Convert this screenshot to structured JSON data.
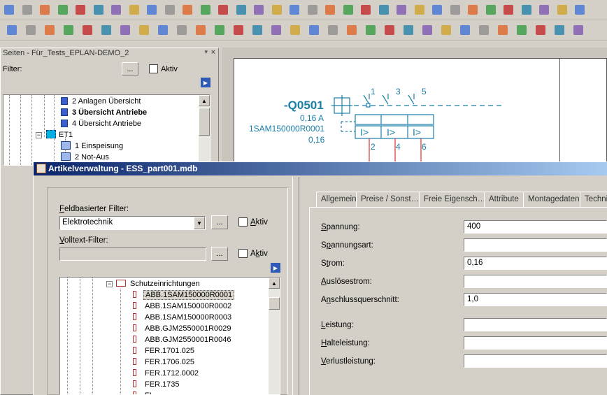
{
  "toolbars": {
    "row1_icons": [
      "new-project-icon",
      "open-project-icon",
      "print-icon",
      "properties-wrench-icon",
      "cut-icon",
      "copy-icon",
      "paste-icon",
      "delete-icon",
      "undo-icon",
      "undo-list-icon",
      "redo-icon",
      "redo-list-icon",
      "report-icon",
      "screen-icon",
      "refresh-icon",
      "zoom-window-icon",
      "zoom-in-icon",
      "zoom-out-icon",
      "zoom-100-icon",
      "forward-icon",
      "back-icon",
      "grid-icon",
      "snap-icon",
      "object-snap-icon",
      "input-grid-icon",
      "grid-toggle-icon",
      "move-icon",
      "connection-icon",
      "crop-icon",
      "omega-symbol-icon",
      "plug-icon",
      "device-icon",
      "terminal-icon"
    ],
    "row2_icons": [
      "lock-icon",
      "tree-icon",
      "bus-icon",
      "page-new-icon",
      "page-copy-icon",
      "page-edit-icon",
      "page-insert-icon",
      "page-export-icon",
      "page-import-icon",
      "macro-icon",
      "macro-window-icon",
      "plc-icon",
      "cable-icon",
      "terminal-strip-icon",
      "insert-device-icon",
      "device-list-icon",
      "symbol-1-icon",
      "symbol-2-icon",
      "symbol-3-icon",
      "symbol-4-icon",
      "symbol-5-icon",
      "symbol-6-icon",
      "wire-icon",
      "black-box-icon",
      "structure-box-icon",
      "placeholder-icon",
      "path-function-icon",
      "cart-icon",
      "parts-icon",
      "folder-open-icon",
      "folder-icon"
    ]
  },
  "pages_panel": {
    "title": "Seiten - Für_Tests_EPLAN-DEMO_2",
    "filter_label": "Filter:",
    "filter_button": "...",
    "aktiv_label": "Aktiv",
    "tree_items": [
      {
        "label": "2 Anlagen Übersicht",
        "bold": false
      },
      {
        "label": "3 Übersicht Antriebe",
        "bold": true
      },
      {
        "label": "4 Übersicht Antriebe",
        "bold": false
      },
      {
        "label": "ET1",
        "bold": false
      },
      {
        "label": "1 Einspeisung",
        "bold": false
      },
      {
        "label": "2 Not-Aus",
        "bold": false
      }
    ],
    "tree_toggle": "−"
  },
  "schematic": {
    "device_tag": "-Q0501",
    "current": "0,16 A",
    "part_number": "1SAM150000R0001",
    "setting": "0,16",
    "terminals_top": [
      "1",
      "3",
      "5"
    ],
    "terminals_bottom": [
      "2",
      "4",
      "6"
    ],
    "trip_symbol": "I>"
  },
  "dialog": {
    "title": "Artikelverwaltung - ESS_part001.mdb",
    "field_filter_label": "Feldbasierter Filter:",
    "field_filter_accel": "F",
    "field_filter_rest": "eldbasierter Filter:",
    "field_filter_value": "Elektrotechnik",
    "fulltext_label": "Volltext-Filter:",
    "fulltext_accel": "V",
    "fulltext_rest": "olltext-Filter:",
    "fulltext_value": "",
    "browse": "...",
    "aktiv_accel": "A",
    "aktiv_rest": "ktiv",
    "aktiv_accel2": "k",
    "aktiv_pre2": "A",
    "aktiv_rest2": "tiv",
    "tree_group": "Schutzeinrichtungen",
    "tree_toggle": "−",
    "parts": [
      "ABB.1SAM150000R0001",
      "ABB.1SAM150000R0002",
      "ABB.1SAM150000R0003",
      "ABB.GJM2550001R0029",
      "ABB.GJM2550001R0046",
      "FER.1701.025",
      "FER.1706.025",
      "FER.1712.0002",
      "FER.1735",
      "FI..."
    ],
    "selected_index": 0,
    "tabs": [
      "Allgemein",
      "Preise / Sonst…",
      "Freie Eigensch…",
      "Attribute",
      "Montagedaten",
      "Techni"
    ],
    "fields": [
      {
        "pre": "",
        "accel": "S",
        "rest": "pannung:",
        "value": "400"
      },
      {
        "pre": "S",
        "accel": "p",
        "rest": "annungsart:",
        "value": ""
      },
      {
        "pre": "S",
        "accel": "t",
        "rest": "rom:",
        "value": "0,16"
      },
      {
        "pre": "",
        "accel": "A",
        "rest": "uslösestrom:",
        "value": ""
      },
      {
        "pre": "A",
        "accel": "n",
        "rest": "schlussquerschnitt:",
        "value": "1,0"
      },
      {
        "pre": "",
        "accel": "L",
        "rest": "eistung:",
        "value": ""
      },
      {
        "pre": "",
        "accel": "H",
        "rest": "alteleistung:",
        "value": ""
      },
      {
        "pre": "",
        "accel": "V",
        "rest": "erlustleistung:",
        "value": ""
      }
    ]
  },
  "colors": {
    "dialog_title_start": "#0a246a",
    "dialog_title_end": "#a6caf0",
    "schematic_blue": "#1a7ea8",
    "selection": "#d9d5cc"
  }
}
